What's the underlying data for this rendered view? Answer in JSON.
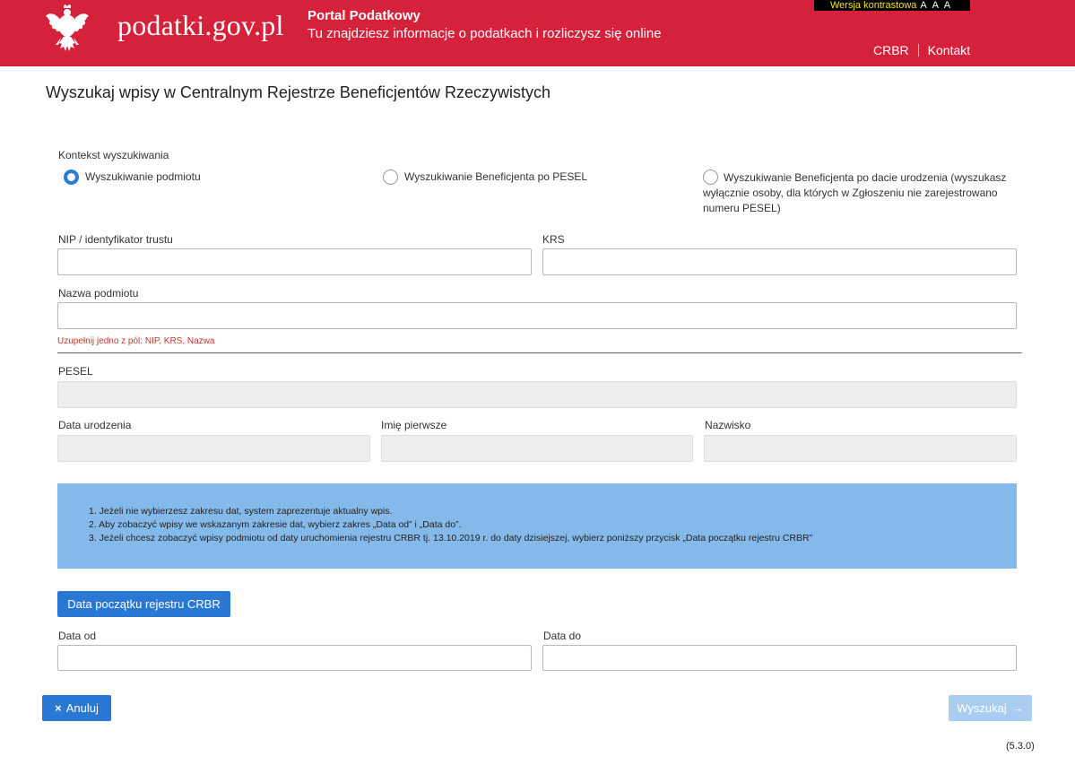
{
  "header": {
    "site_name": "podatki.gov.pl",
    "portal_title": "Portal Podatkowy",
    "portal_subtitle": "Tu znajdziesz informacje o podatkach i rozliczysz się online",
    "contrast_label": "Wersja kontrastowa",
    "font_size_label": "A A A",
    "links": [
      "CRBR",
      "Kontakt"
    ],
    "brand_color": "#d6213b"
  },
  "page_title": "Wyszukaj wpisy w Centralnym Rejestrze Beneficjentów Rzeczywistych",
  "search_context": {
    "label": "Kontekst wyszukiwania",
    "options": [
      {
        "label": "Wyszukiwanie podmiotu",
        "selected": true
      },
      {
        "label": "Wyszukiwanie Beneficjenta po PESEL",
        "selected": false
      },
      {
        "label_lines": [
          "Wyszukiwanie Beneficjenta po dacie urodzenia (wyszukasz",
          "wyłącznie osoby, dla których w Zgłoszeniu nie zarejestrowano",
          "numeru PESEL)"
        ],
        "selected": false
      }
    ]
  },
  "fields": {
    "nip_label": "NIP / identyfikator trustu",
    "nip_value": "",
    "krs_label": "KRS",
    "krs_value": "",
    "name_label": "Nazwa podmiotu",
    "name_value": "",
    "hint": "Uzupełnij jedno z pól: NIP, KRS, Nazwa",
    "pesel_label": "PESEL",
    "birth_date_label": "Data urodzenia",
    "first_name_label": "Imię pierwsze",
    "surname_label": "Nazwisko"
  },
  "info": [
    "1. Jeżeli nie wybierzesz zakresu dat, system zaprezentuje aktualny wpis.",
    "2. Aby zobaczyć wpisy we wskazanym zakresie dat, wybierz zakres „Data od” i „Data do”.",
    "3. Jeżeli chcesz zobaczyć wpisy podmiotu od daty uruchomienia rejestru CRBR tj. 13.10.2019 r. do daty dzisiejszej, wybierz poniższy przycisk „Data początku rejestru CRBR”"
  ],
  "date_range": {
    "start_button": "Data początku rejestru CRBR",
    "from_label": "Data od",
    "to_label": "Data do"
  },
  "actions": {
    "cancel_icon": "×",
    "cancel_label": "Anuluj",
    "search_label": "Wyszukaj",
    "search_icon": "→"
  },
  "version": "(5.3.0)"
}
